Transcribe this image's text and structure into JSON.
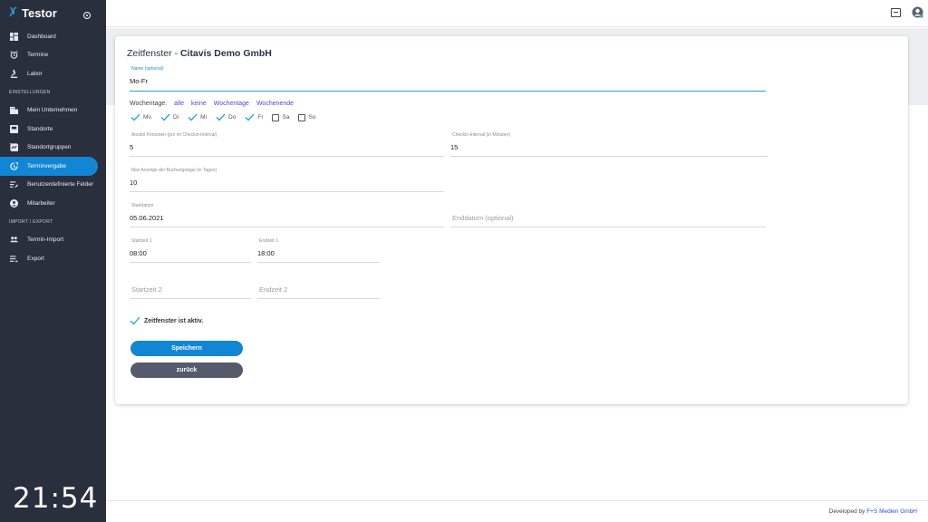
{
  "sidebar": {
    "app_name": "Testor",
    "clock": "21:54",
    "items": [
      {
        "label": "Dashboard",
        "icon": "dashboard-icon"
      },
      {
        "label": "Termine",
        "icon": "alarm-icon"
      },
      {
        "label": "Labor",
        "icon": "microscope-icon"
      }
    ],
    "section_settings": "EINSTELLUNGEN",
    "settings_items": [
      {
        "label": "Mein Unternehmen",
        "icon": "building-icon"
      },
      {
        "label": "Standorte",
        "icon": "location-icon"
      },
      {
        "label": "Standortgruppen",
        "icon": "group-icon"
      },
      {
        "label": "Terminvergabe",
        "icon": "schedule-icon",
        "active": true
      },
      {
        "label": "Benutzerdefinierte Felder",
        "icon": "fields-icon"
      },
      {
        "label": "Mitarbeiter",
        "icon": "person-icon"
      }
    ],
    "section_import": "IMPORT / EXPORT",
    "import_items": [
      {
        "label": "Termin-Import",
        "icon": "import-icon"
      },
      {
        "label": "Export",
        "icon": "export-icon"
      }
    ]
  },
  "header": {
    "icons": [
      "scan-icon",
      "user-avatar-icon"
    ]
  },
  "form": {
    "title_prefix": "Zeitfenster - ",
    "title_company": "Citavis Demo GmbH",
    "name_label": "Name (optional)",
    "name_value": "Mo-Fr",
    "weekdays_label": "Wochentage:",
    "weekday_links": [
      "alle",
      "keine",
      "Wochentage",
      "Wochenende"
    ],
    "days": [
      {
        "label": "Mo",
        "checked": true
      },
      {
        "label": "Di",
        "checked": true
      },
      {
        "label": "Mi",
        "checked": true
      },
      {
        "label": "Do",
        "checked": true
      },
      {
        "label": "Fr",
        "checked": true
      },
      {
        "label": "Sa",
        "checked": false
      },
      {
        "label": "So",
        "checked": false
      }
    ],
    "persons_label": "Anzahl Personen (pro im Checkin-Interval)",
    "persons_value": "5",
    "interval_label": "Checkin-Interval (in Minuten)",
    "interval_value": "15",
    "maxdays_label": "Max Anzeige der Buchungstage (in Tagen)",
    "maxdays_value": "10",
    "start_date_label": "Startdatum",
    "start_date_value": "05.06.2021",
    "end_date_placeholder": "Enddatum (optional)",
    "start1_label": "Startzeit 1",
    "start1_value": "08:00",
    "end1_label": "Endzeit 1",
    "end1_value": "18:00",
    "start2_placeholder": "Startzeit 2",
    "end2_placeholder": "Endzeit 2",
    "active_label": "Zeitfenster ist aktiv.",
    "save_label": "Speichern",
    "back_label": "zurück"
  },
  "footer": {
    "prefix": "Developed by ",
    "company": "F+S Medien GmbH"
  },
  "colors": {
    "sidebar_bg": "#2a2f3d",
    "accent": "#1186d4",
    "check": "#22a5d8",
    "link": "#4a4ae0",
    "back_button": "#565b6c"
  }
}
